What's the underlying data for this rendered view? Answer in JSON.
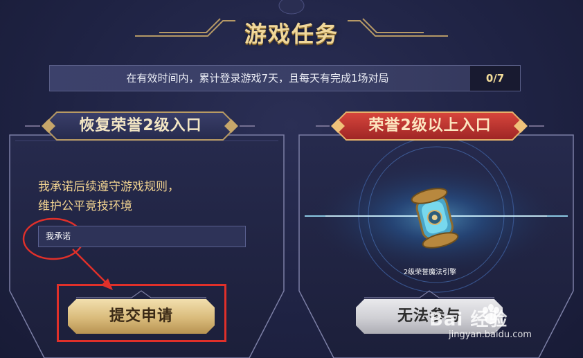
{
  "header": {
    "title": "游戏任务"
  },
  "task": {
    "description": "在有效时间内，累计登录游戏7天，且每天有完成1场对局",
    "progress": "0/7"
  },
  "left_panel": {
    "tab_label": "恢复荣誉2级入口",
    "pledge_line1": "我承诺后续遵守游戏规则，",
    "pledge_line2": "维护公平竞技环境",
    "input_value": "我承诺",
    "submit_label": "提交申请"
  },
  "right_panel": {
    "tab_label": "荣誉2级以上入口",
    "item_caption": "2级荣誉魔法引擎",
    "button_label": "无法参与"
  },
  "watermark": {
    "logo": "Bai 经验",
    "url": "jingyan.baidu.com"
  },
  "colors": {
    "gold": "#f0d79a",
    "tab_red": "#b8302c",
    "annotation_red": "#e0302a",
    "background": "#1f2344"
  },
  "icons": [
    "header-ornament-icon",
    "magic-engine-icon",
    "tab-diamond-icon",
    "baidu-paw-icon"
  ]
}
